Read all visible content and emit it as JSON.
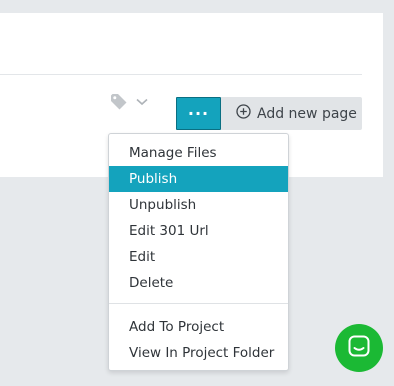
{
  "toolbar": {
    "more_label": "...",
    "add_page_label": "Add new page"
  },
  "dropdown": {
    "group1": [
      {
        "label": "Manage Files"
      },
      {
        "label": "Publish",
        "active": true
      },
      {
        "label": "Unpublish"
      },
      {
        "label": "Edit 301 Url"
      },
      {
        "label": "Edit"
      },
      {
        "label": "Delete"
      }
    ],
    "group2": [
      {
        "label": "Add To Project"
      },
      {
        "label": "View In Project Folder"
      }
    ]
  },
  "colors": {
    "accent": "#14a3bd",
    "chat": "#1bb934",
    "background": "#e6e9ec"
  },
  "icons": [
    "tag-icon",
    "chevron-down-icon",
    "plus-circle-icon",
    "chat-icon"
  ]
}
